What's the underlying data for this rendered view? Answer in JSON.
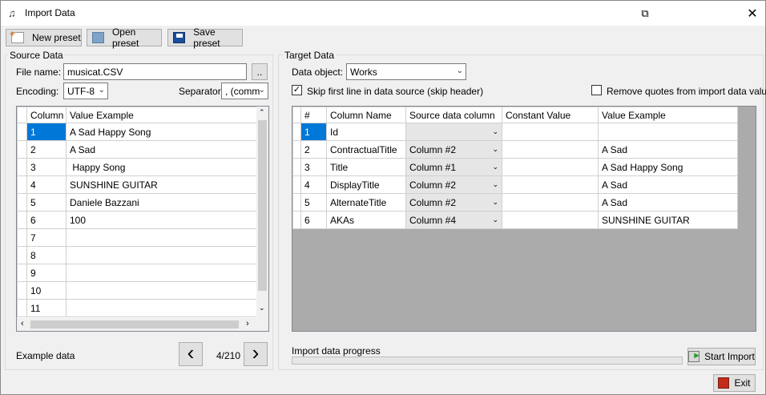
{
  "window": {
    "title": "Import Data"
  },
  "toolbar": {
    "new_preset": "New preset",
    "open_preset": "Open preset",
    "save_preset": "Save preset"
  },
  "source": {
    "group_label": "Source Data",
    "file_name_label": "File name:",
    "file_name_value": "musicat.CSV",
    "browse_label": "..",
    "encoding_label": "Encoding:",
    "encoding_value": "UTF-8",
    "separator_label": "Separator:",
    "separator_value": ", (comm",
    "columns": [
      "Column",
      "Value Example"
    ],
    "rows": [
      {
        "column": "1",
        "value": "A Sad Happy Song"
      },
      {
        "column": "2",
        "value": "A Sad"
      },
      {
        "column": "3",
        "value": " Happy Song"
      },
      {
        "column": "4",
        "value": "SUNSHINE GUITAR"
      },
      {
        "column": "5",
        "value": "Daniele Bazzani"
      },
      {
        "column": "6",
        "value": "100"
      },
      {
        "column": "7",
        "value": ""
      },
      {
        "column": "8",
        "value": ""
      },
      {
        "column": "9",
        "value": ""
      },
      {
        "column": "10",
        "value": ""
      },
      {
        "column": "11",
        "value": ""
      }
    ],
    "example_label": "Example data",
    "page_counter": "4/210"
  },
  "target": {
    "group_label": "Target Data",
    "data_object_label": "Data object:",
    "data_object_value": "Works",
    "skip_first_line_label": "Skip first line in data source (skip header)",
    "skip_first_line_checked": true,
    "remove_quotes_label": "Remove quotes from import data values",
    "remove_quotes_checked": false,
    "columns": [
      "#",
      "Column Name",
      "Source data column",
      "Constant Value",
      "Value Example"
    ],
    "rows": [
      {
        "num": "1",
        "name": "Id",
        "source": "",
        "constant": "",
        "example": ""
      },
      {
        "num": "2",
        "name": "ContractualTitle",
        "source": "Column #2",
        "constant": "",
        "example": "A Sad"
      },
      {
        "num": "3",
        "name": "Title",
        "source": "Column #1",
        "constant": "",
        "example": "A Sad Happy Song"
      },
      {
        "num": "4",
        "name": "DisplayTitle",
        "source": "Column #2",
        "constant": "",
        "example": "A Sad"
      },
      {
        "num": "5",
        "name": "AlternateTitle",
        "source": "Column #2",
        "constant": "",
        "example": "A Sad"
      },
      {
        "num": "6",
        "name": "AKAs",
        "source": "Column #4",
        "constant": "",
        "example": "SUNSHINE GUITAR"
      }
    ],
    "progress_label": "Import data progress",
    "progress_value": 0,
    "start_import": "Start Import"
  },
  "footer": {
    "exit": "Exit"
  }
}
